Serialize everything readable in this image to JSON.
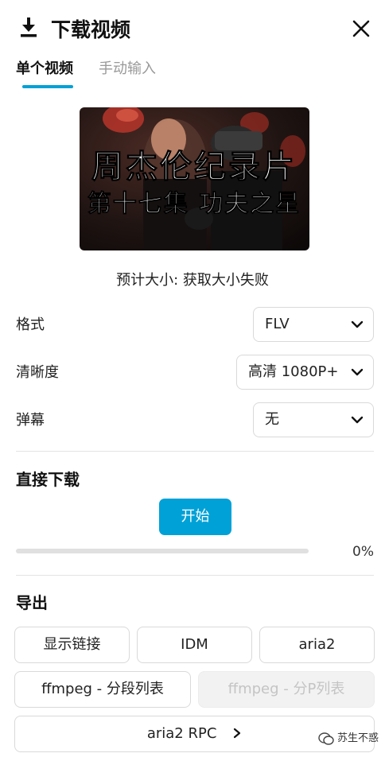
{
  "header": {
    "title": "下载视频",
    "icons": {
      "download": "download-icon",
      "close": "close-icon"
    }
  },
  "tabs": [
    {
      "label": "单个视频",
      "active": true
    },
    {
      "label": "手动输入",
      "active": false
    }
  ],
  "thumbnail": {
    "caption_line1": "周杰伦纪录片",
    "caption_line2": "第十七集 功夫之星"
  },
  "estimate_text": "预计大小: 获取大小失败",
  "options": {
    "format": {
      "label": "格式",
      "value": "FLV"
    },
    "quality": {
      "label": "清晰度",
      "value": "高清 1080P+"
    },
    "danmaku": {
      "label": "弹幕",
      "value": "无"
    }
  },
  "direct_download": {
    "title": "直接下载",
    "start_label": "开始",
    "progress_percent": 0,
    "progress_text": "0%"
  },
  "export": {
    "title": "导出",
    "buttons": {
      "show_links": "显示链接",
      "idm": "IDM",
      "aria2": "aria2",
      "ffmpeg_segments": "ffmpeg - 分段列表",
      "ffmpeg_parts": "ffmpeg - 分P列表",
      "aria2_rpc": "aria2 RPC"
    },
    "disabled": [
      "ffmpeg_parts"
    ]
  },
  "watermark": {
    "text": "苏生不惑"
  },
  "colors": {
    "accent": "#00a1d6",
    "border": "#d9d9d9",
    "disabled_bg": "#f2f2f2"
  }
}
